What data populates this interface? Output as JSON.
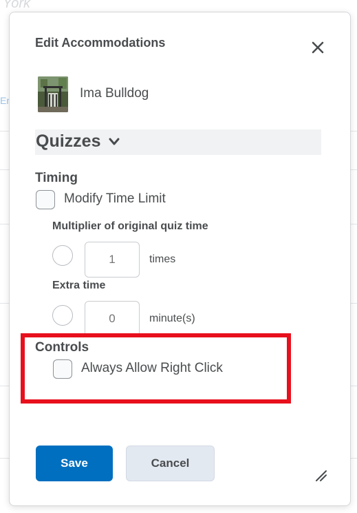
{
  "background": {
    "partial_heading": "York",
    "partial_link": "Er"
  },
  "dialog": {
    "title": "Edit Accommodations",
    "close_icon": "close-icon",
    "user": {
      "name": "Ima Bulldog",
      "avatar_icon": "user-photo"
    },
    "section": {
      "title": "Quizzes",
      "expand_icon": "chevron-down-icon"
    },
    "timing": {
      "heading": "Timing",
      "modify_time_limit": {
        "label": "Modify Time Limit",
        "checked": false
      },
      "multiplier": {
        "label": "Multiplier of original quiz time",
        "placeholder": "1",
        "unit": "times",
        "selected": false
      },
      "extra_time": {
        "label": "Extra time",
        "placeholder": "0",
        "unit": "minute(s)",
        "selected": false
      }
    },
    "controls": {
      "heading": "Controls",
      "always_allow_right_click": {
        "label": "Always Allow Right Click",
        "checked": false
      }
    },
    "buttons": {
      "save": "Save",
      "cancel": "Cancel"
    },
    "resize_icon": "resize-handle-icon"
  },
  "colors": {
    "primary": "#006fbf",
    "secondary_button": "#e3e9f1",
    "highlight": "#e8101c",
    "text": "#494c4e"
  }
}
